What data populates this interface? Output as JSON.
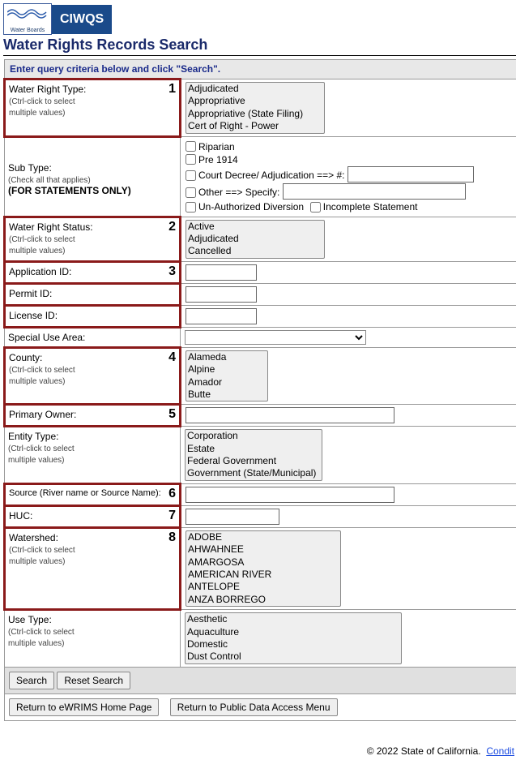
{
  "logos": {
    "waterboards": "Water Boards",
    "ciwqs": "CIWQS"
  },
  "page_title": "Water Rights Records Search",
  "instruction": "Enter query criteria below and click \"Search\".",
  "ctrl_hint": "(Ctrl-click to select\nmultiple values)",
  "rows": {
    "wr_type": {
      "label": "Water Right Type:",
      "num": "1",
      "options": [
        "Adjudicated",
        "Appropriative",
        "Appropriative (State Filing)",
        "Cert of Right - Power"
      ]
    },
    "sub_type": {
      "label": "Sub Type:",
      "hint": "(Check all that applies)",
      "bold": "(FOR STATEMENTS ONLY)",
      "riparian": "Riparian",
      "pre1914": "Pre 1914",
      "court": "Court Decree/ Adjudication   ==> #:",
      "other": "Other  ==> Specify:",
      "unauth": "Un-Authorized Diversion",
      "incomplete": "Incomplete Statement"
    },
    "wr_status": {
      "label": "Water Right Status:",
      "num": "2",
      "options": [
        "Active",
        "Adjudicated",
        "Cancelled"
      ]
    },
    "app_id": {
      "label": "Application ID:",
      "num": "3"
    },
    "permit_id": {
      "label": "Permit ID:"
    },
    "license_id": {
      "label": "License ID:"
    },
    "special_use": {
      "label": "Special Use Area:"
    },
    "county": {
      "label": "County:",
      "num": "4",
      "options": [
        "Alameda",
        "Alpine",
        "Amador",
        "Butte"
      ]
    },
    "primary_owner": {
      "label": "Primary Owner:",
      "num": "5"
    },
    "entity_type": {
      "label": "Entity Type:",
      "options": [
        "Corporation",
        "Estate",
        "Federal Government",
        "Government (State/Municipal)"
      ]
    },
    "source": {
      "label": "Source (River name or Source Name):",
      "num": "6"
    },
    "huc": {
      "label": "HUC:",
      "num": "7"
    },
    "watershed": {
      "label": "Watershed:",
      "num": "8",
      "options": [
        "ADOBE",
        "AHWAHNEE",
        "AMARGOSA",
        "AMERICAN RIVER",
        "ANTELOPE",
        "ANZA BORREGO"
      ]
    },
    "use_type": {
      "label": "Use Type:",
      "options": [
        "Aesthetic",
        "Aquaculture",
        "Domestic",
        "Dust Control"
      ]
    }
  },
  "buttons": {
    "search": "Search",
    "reset": "Reset Search",
    "return_home": "Return to eWRIMS Home Page",
    "return_menu": "Return to Public Data Access Menu"
  },
  "footer": {
    "copyright": "© 2022 State of California.",
    "link": "Condit"
  }
}
